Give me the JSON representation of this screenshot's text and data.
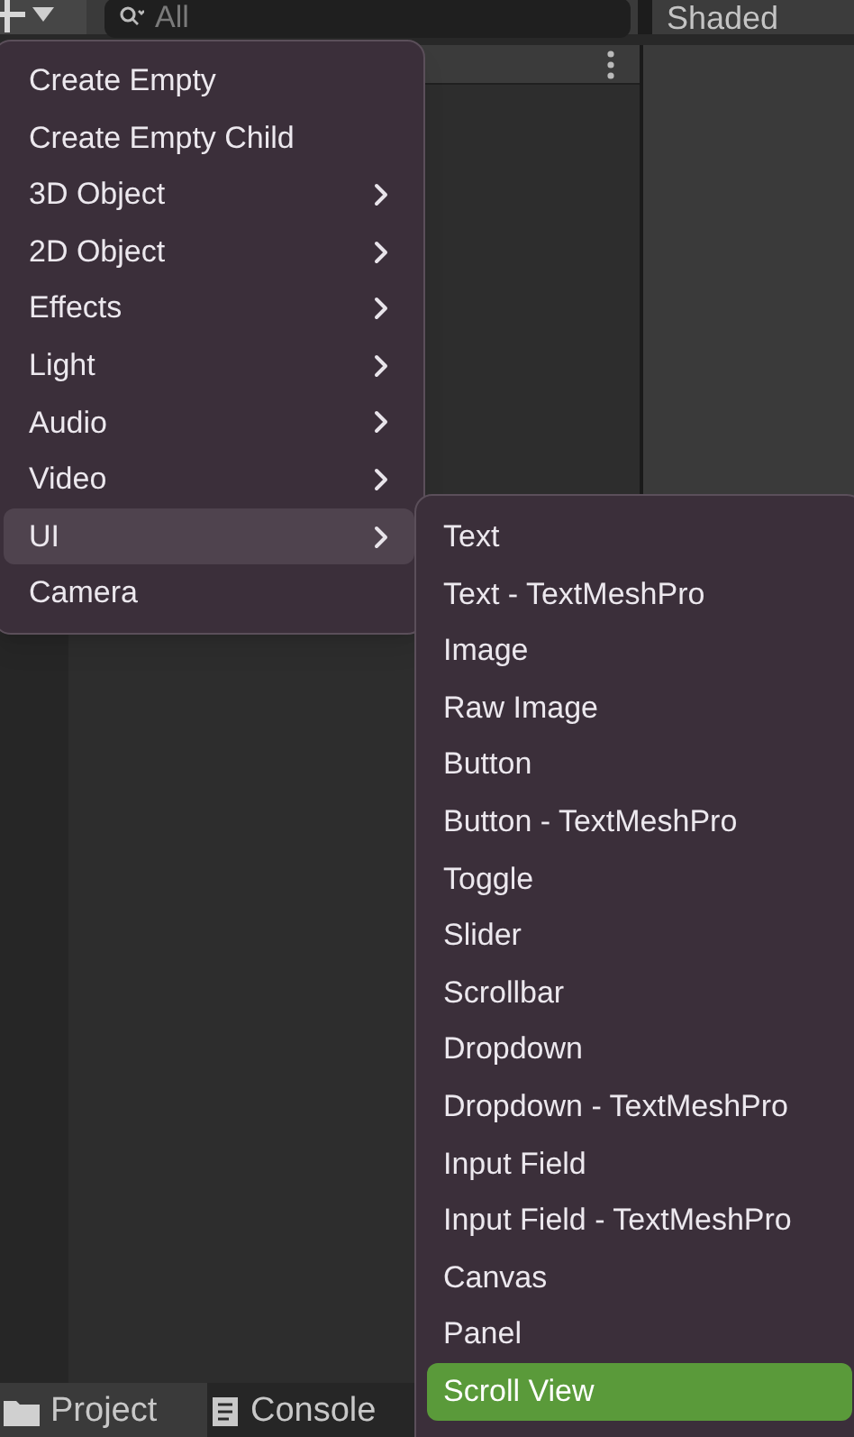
{
  "toolbar": {
    "search": {
      "placeholder": "All"
    },
    "shading_mode": "Shaded"
  },
  "bottom_tabs": [
    {
      "label": "Project",
      "kind": "folder",
      "selected": true
    },
    {
      "label": "Console",
      "kind": "console",
      "selected": false
    }
  ],
  "menu": {
    "items": [
      {
        "label": "Create Empty",
        "submenu": false,
        "selected": false
      },
      {
        "label": "Create Empty Child",
        "submenu": false,
        "selected": false
      },
      {
        "label": "3D Object",
        "submenu": true,
        "selected": false
      },
      {
        "label": "2D Object",
        "submenu": true,
        "selected": false
      },
      {
        "label": "Effects",
        "submenu": true,
        "selected": false
      },
      {
        "label": "Light",
        "submenu": true,
        "selected": false
      },
      {
        "label": "Audio",
        "submenu": true,
        "selected": false
      },
      {
        "label": "Video",
        "submenu": true,
        "selected": false
      },
      {
        "label": "UI",
        "submenu": true,
        "selected": true
      },
      {
        "label": "Camera",
        "submenu": false,
        "selected": false
      }
    ]
  },
  "submenu": {
    "items": [
      {
        "label": "Text",
        "selected": false
      },
      {
        "label": "Text - TextMeshPro",
        "selected": false
      },
      {
        "label": "Image",
        "selected": false
      },
      {
        "label": "Raw Image",
        "selected": false
      },
      {
        "label": "Button",
        "selected": false
      },
      {
        "label": "Button - TextMeshPro",
        "selected": false
      },
      {
        "label": "Toggle",
        "selected": false
      },
      {
        "label": "Slider",
        "selected": false
      },
      {
        "label": "Scrollbar",
        "selected": false
      },
      {
        "label": "Dropdown",
        "selected": false
      },
      {
        "label": "Dropdown - TextMeshPro",
        "selected": false
      },
      {
        "label": "Input Field",
        "selected": false
      },
      {
        "label": "Input Field - TextMeshPro",
        "selected": false
      },
      {
        "label": "Canvas",
        "selected": false
      },
      {
        "label": "Panel",
        "selected": false
      },
      {
        "label": "Scroll View",
        "selected": true
      }
    ]
  }
}
